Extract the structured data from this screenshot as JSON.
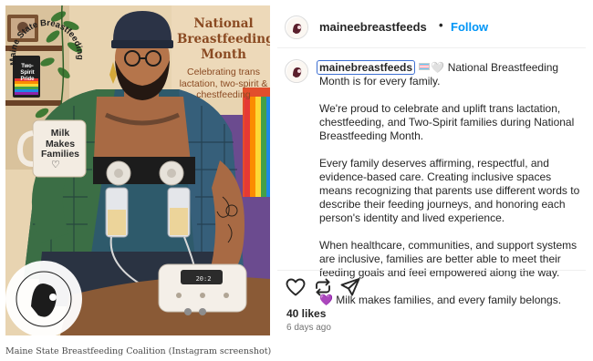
{
  "post": {
    "account": "maineebreastfeeds",
    "follow_label": "Follow",
    "separator": "•"
  },
  "illustration": {
    "title": "National Breastfeeding Month",
    "subtitle": "Celebrating trans lactation, two-spirit & chestfeeding",
    "mug_text": "Milk Makes Families",
    "mug_heart": "♡",
    "pride_sign": "Two-Spirit Pride",
    "pump_display": "20:2",
    "logo_text": "Maine State Breastfeeding"
  },
  "caption": {
    "handle": "mainebreastfeeds",
    "opening": "National Breastfeeding Month is for every family.",
    "emoji_white_heart": "🤍",
    "paragraphs": [
      "We're proud to celebrate and uplift trans lactation, chestfeeding, and Two-Spirit families during National Breastfeeding Month.",
      "Every family deserves affirming, respectful, and evidence-based care. Creating inclusive spaces means recognizing that parents use different words to describe their feeding journeys, and honoring each person's identity and lived experience.",
      "When healthcare, communities, and support systems are inclusive, families are better able to meet their feeding goals and feel empowered along the way."
    ],
    "closing_emoji": "💜",
    "closing": "Milk makes families, and every family belongs."
  },
  "stats": {
    "likes": "40 likes",
    "time": "6 days ago"
  },
  "icons": {
    "like": "heart-icon",
    "repost": "repost-icon",
    "share": "send-icon"
  },
  "credit": "Maine State Breastfeeding Coalition (Instagram screenshot)",
  "colors": {
    "follow": "#0095f6",
    "handle_outline": "#3d6fd1",
    "title_text": "#8a4a22"
  }
}
